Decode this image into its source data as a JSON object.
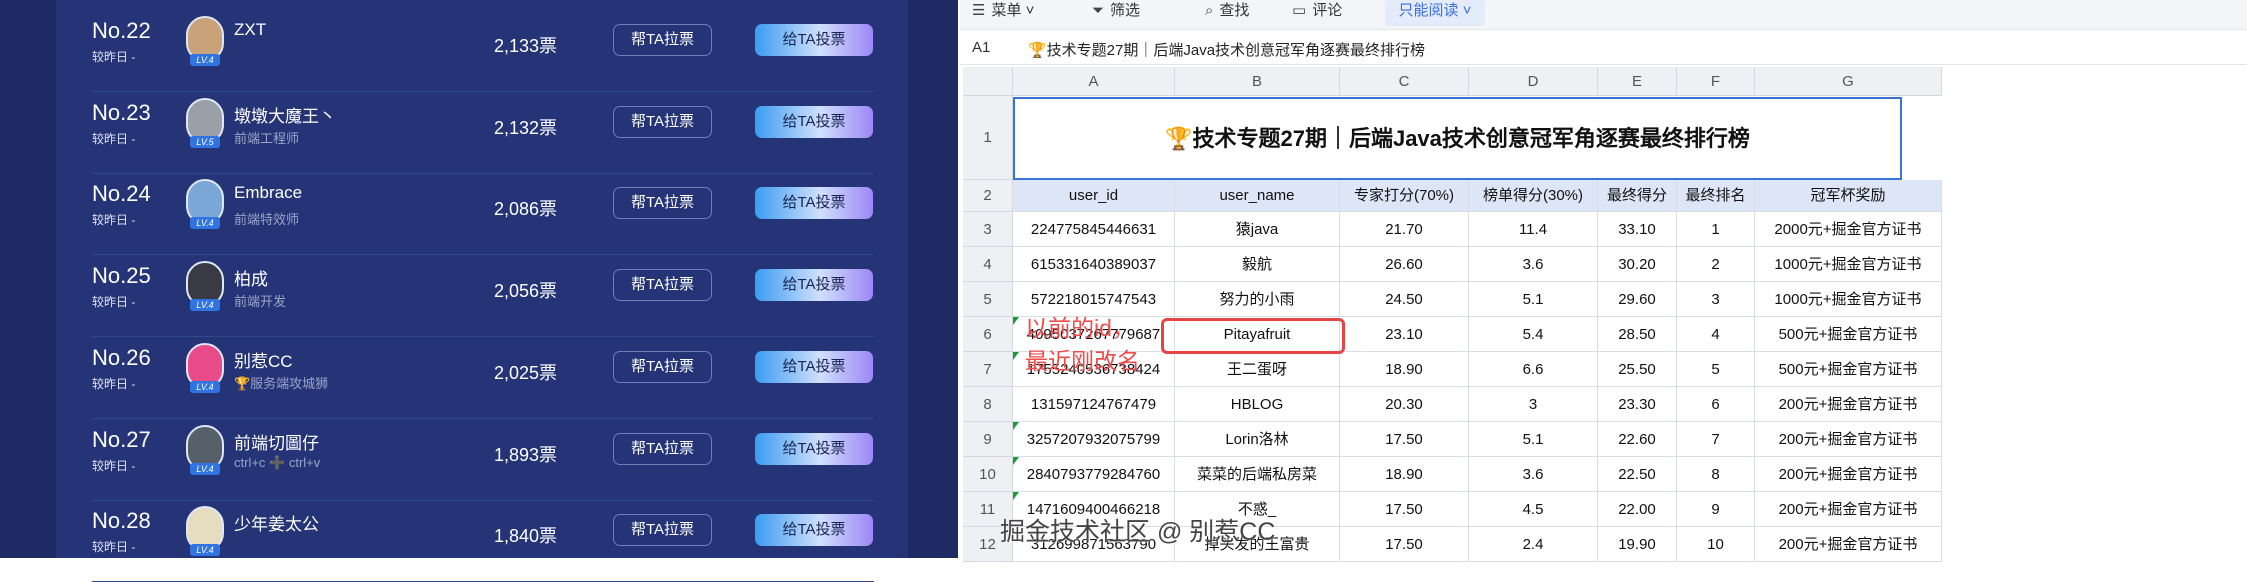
{
  "leaderboard": {
    "help_label": "帮TA拉票",
    "vote_label": "给TA投票",
    "rows": [
      {
        "rank": "No.22",
        "sub": "较昨日 -",
        "name": "ZXT",
        "title": "",
        "level": "LV.4",
        "votes": "2,133票",
        "avatar_color": "#c9a27a"
      },
      {
        "rank": "No.23",
        "sub": "较昨日 -",
        "name": "墩墩大魔王丶",
        "title": "前端工程师",
        "level": "LV.5",
        "votes": "2,132票",
        "avatar_color": "#9aa0a8"
      },
      {
        "rank": "No.24",
        "sub": "较昨日 -",
        "name": "Embrace",
        "title": "前端特效师",
        "level": "LV.4",
        "votes": "2,086票",
        "avatar_color": "#7aa6d8"
      },
      {
        "rank": "No.25",
        "sub": "较昨日 -",
        "name": "柏成",
        "title": "前端开发",
        "level": "LV.4",
        "votes": "2,056票",
        "avatar_color": "#3a3a44"
      },
      {
        "rank": "No.26",
        "sub": "较昨日 -",
        "name": "别惹CC",
        "title": "🏆服务端攻城狮",
        "level": "LV.4",
        "votes": "2,025票",
        "avatar_color": "#e84a8a"
      },
      {
        "rank": "No.27",
        "sub": "较昨日 -",
        "name": "前端切圖仔",
        "title": "ctrl+c ➕ ctrl+v",
        "level": "LV.4",
        "votes": "1,893票",
        "avatar_color": "#55606a"
      },
      {
        "rank": "No.28",
        "sub": "较昨日 -",
        "name": "少年姜太公",
        "title": "",
        "level": "LV.4",
        "votes": "1,840票",
        "avatar_color": "#e6dcc0"
      }
    ]
  },
  "sheet": {
    "toolbar": {
      "menu": "菜单",
      "filter": "筛选",
      "find": "查找",
      "comment": "评论",
      "mode": "只能阅读"
    },
    "cell_ref": "A1",
    "formula": "🏆技术专题27期｜后端Java技术创意冠军角逐赛最终排行榜",
    "columns": [
      "A",
      "B",
      "C",
      "D",
      "E",
      "F",
      "G"
    ],
    "title": "🏆技术专题27期｜后端Java技术创意冠军角逐赛最终排行榜",
    "headers": [
      "user_id",
      "user_name",
      "专家打分(70%)",
      "榜单得分(30%)",
      "最终得分",
      "最终排名",
      "冠军杯奖励"
    ],
    "rows": [
      {
        "n": "3",
        "cells": [
          "224775845446631",
          "猿java",
          "21.70",
          "11.4",
          "33.10",
          "1",
          "2000元+掘金官方证书"
        ],
        "flag": false
      },
      {
        "n": "4",
        "cells": [
          "615331640389037",
          "毅航",
          "26.60",
          "3.6",
          "30.20",
          "2",
          "1000元+掘金官方证书"
        ],
        "flag": false
      },
      {
        "n": "5",
        "cells": [
          "572218015747543",
          "努力的小雨",
          "24.50",
          "5.1",
          "29.60",
          "3",
          "1000元+掘金官方证书"
        ],
        "flag": false
      },
      {
        "n": "6",
        "cells": [
          "4095037267779687",
          "Pitayafruit",
          "23.10",
          "5.4",
          "28.50",
          "4",
          "500元+掘金官方证书"
        ],
        "flag": true
      },
      {
        "n": "7",
        "cells": [
          "1755240536738424",
          "王二蛋呀",
          "18.90",
          "6.6",
          "25.50",
          "5",
          "500元+掘金官方证书"
        ],
        "flag": true
      },
      {
        "n": "8",
        "cells": [
          "131597124767479",
          "HBLOG",
          "20.30",
          "3",
          "23.30",
          "6",
          "200元+掘金官方证书"
        ],
        "flag": false
      },
      {
        "n": "9",
        "cells": [
          "3257207932075799",
          "Lorin洛林",
          "17.50",
          "5.1",
          "22.60",
          "7",
          "200元+掘金官方证书"
        ],
        "flag": true
      },
      {
        "n": "10",
        "cells": [
          "2840793779284760",
          "菜菜的后端私房菜",
          "18.90",
          "3.6",
          "22.50",
          "8",
          "200元+掘金官方证书"
        ],
        "flag": true
      },
      {
        "n": "11",
        "cells": [
          "1471609400466218",
          "不惑_",
          "17.50",
          "4.5",
          "22.00",
          "9",
          "200元+掘金官方证书"
        ],
        "flag": true
      },
      {
        "n": "12",
        "cells": [
          "312699871563790",
          "掉头发的王富贵",
          "17.50",
          "2.4",
          "19.90",
          "10",
          "200元+掘金官方证书"
        ],
        "flag": false
      }
    ],
    "annotation_line1": "以前的id，",
    "annotation_line2": "最近刚改名"
  },
  "watermark": "掘金技术社区 @ 别惹CC"
}
